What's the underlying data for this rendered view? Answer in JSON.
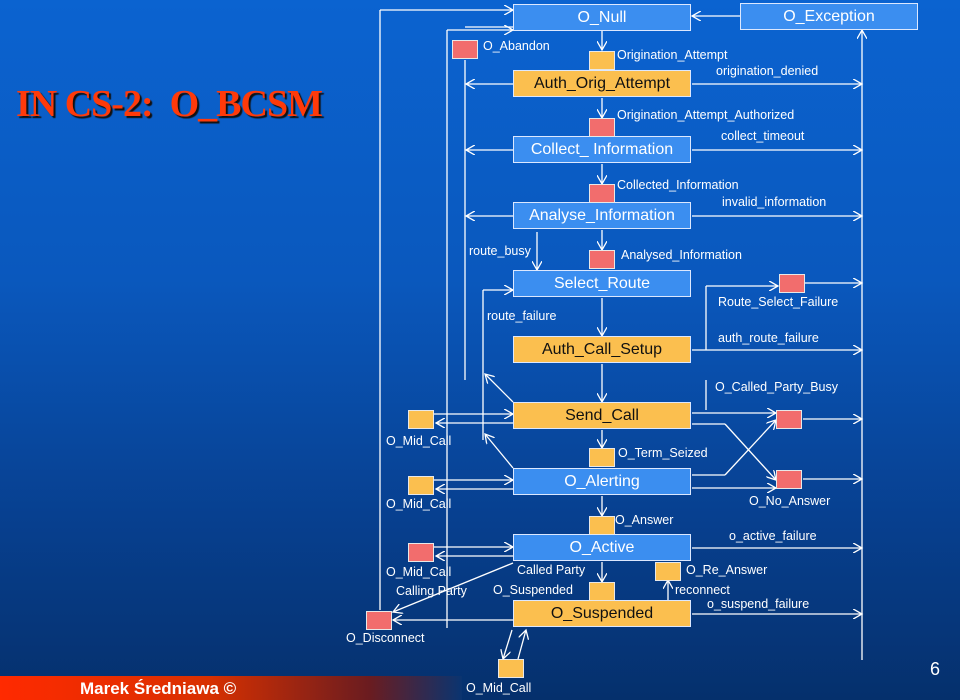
{
  "title": "IN CS-2:  O_BCSM",
  "states": {
    "o_null": "O_Null",
    "o_exception": "O_Exception",
    "auth_orig_attempt": "Auth_Orig_Attempt",
    "collect_information": "Collect_ Information",
    "analyse_information": "Analyse_Information",
    "select_route": "Select_Route",
    "auth_call_setup": "Auth_Call_Setup",
    "send_call": "Send_Call",
    "o_alerting": "O_Alerting",
    "o_active": "O_Active",
    "o_suspended": "O_Suspended"
  },
  "labels": {
    "o_abandon": "O_Abandon",
    "origination_attempt": "Origination_Attempt",
    "origination_denied": "origination_denied",
    "origination_attempt_authorized": "Origination_Attempt_Authorized",
    "collect_timeout": "collect_timeout",
    "collected_information": "Collected_Information",
    "invalid_information": "invalid_information",
    "route_busy": "route_busy",
    "analysed_information": "Analysed_Information",
    "route_select_failure": "Route_Select_Failure",
    "route_failure": "route_failure",
    "auth_route_failure": "auth_route_failure",
    "o_called_party_busy": "O_Called_Party_Busy",
    "o_mid_call_1": "O_Mid_Call",
    "o_term_seized": "O_Term_Seized",
    "o_mid_call_2": "O_Mid_Call",
    "o_no_answer": "O_No_Answer",
    "o_answer": "O_Answer",
    "o_active_failure": "o_active_failure",
    "o_mid_call_3": "O_Mid_Call",
    "called_party": "Called Party",
    "o_re_answer": "O_Re_Answer",
    "calling_party": "Calling Party",
    "o_suspended_dp": "O_Suspended",
    "reconnect": "reconnect",
    "o_suspend_failure": "o_suspend_failure",
    "o_disconnect": "O_Disconnect",
    "o_mid_call_4": "O_Mid_Call"
  },
  "footer": {
    "author": "Marek Średniawa ©",
    "page": "6"
  },
  "colors": {
    "state_blue": "#3b8ef0",
    "state_orange": "#fbbf4f",
    "dp_red": "#f26d6d",
    "dp_orange": "#fbbf4f",
    "title": "#ff3a0a"
  }
}
